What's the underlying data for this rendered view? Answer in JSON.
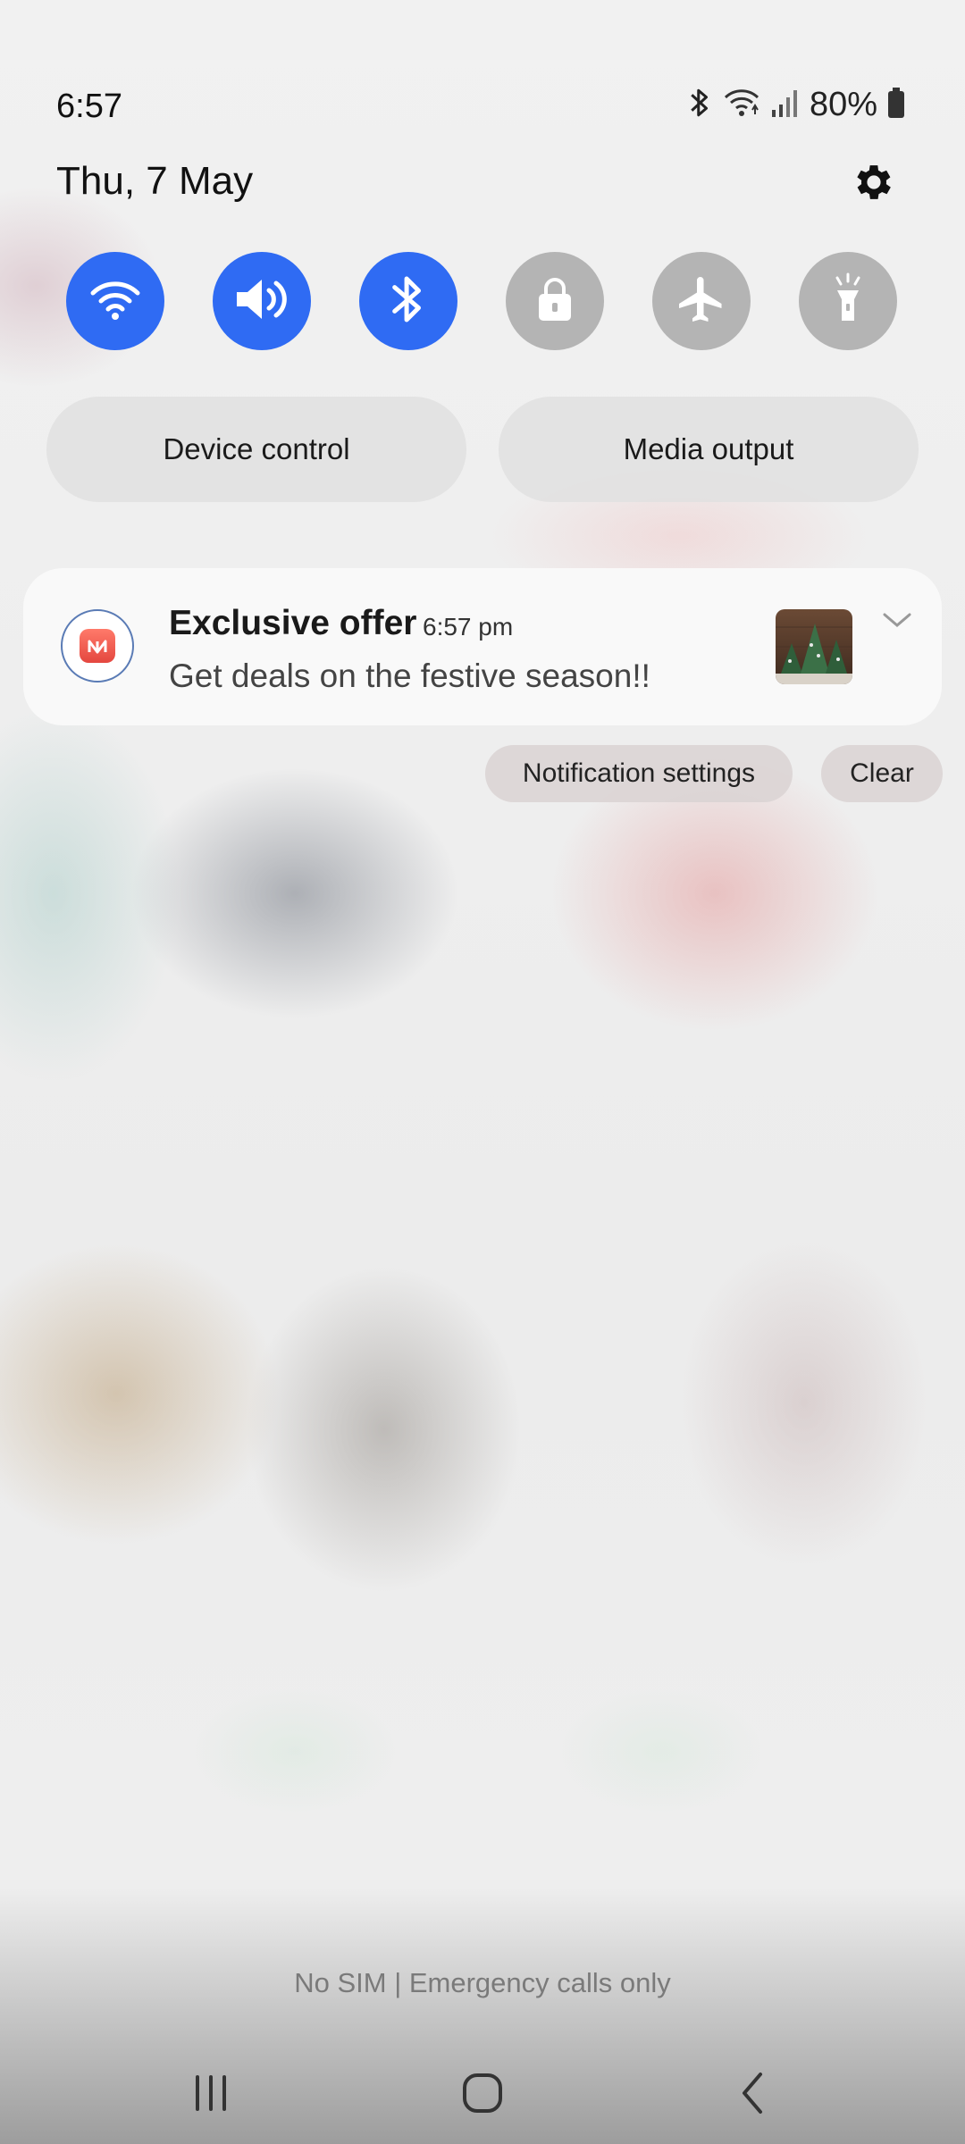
{
  "status_bar": {
    "time": "6:57",
    "battery_percent": "80%",
    "icons": [
      "bluetooth-icon",
      "wifi-icon",
      "signal-icon",
      "battery-icon"
    ]
  },
  "date": "Thu, 7 May",
  "quick_toggles": [
    {
      "name": "wifi",
      "icon": "wifi-icon",
      "state": "on"
    },
    {
      "name": "sound",
      "icon": "speaker-icon",
      "state": "on"
    },
    {
      "name": "bluetooth",
      "icon": "bluetooth-icon",
      "state": "on"
    },
    {
      "name": "screen-lock",
      "icon": "lock-icon",
      "state": "off"
    },
    {
      "name": "airplane-mode",
      "icon": "airplane-icon",
      "state": "off"
    },
    {
      "name": "flashlight",
      "icon": "flashlight-icon",
      "state": "off"
    }
  ],
  "panel_buttons": {
    "device_control": "Device control",
    "media_output": "Media output"
  },
  "notification": {
    "title": "Exclusive offer",
    "time": "6:57 pm",
    "body": "Get deals on the festive season!!"
  },
  "notification_actions": {
    "settings": "Notification settings",
    "clear": "Clear"
  },
  "carrier_text": "No SIM | Emergency calls only",
  "colors": {
    "accent": "#2f6bf3",
    "toggle_off": "#b4b4b4"
  }
}
